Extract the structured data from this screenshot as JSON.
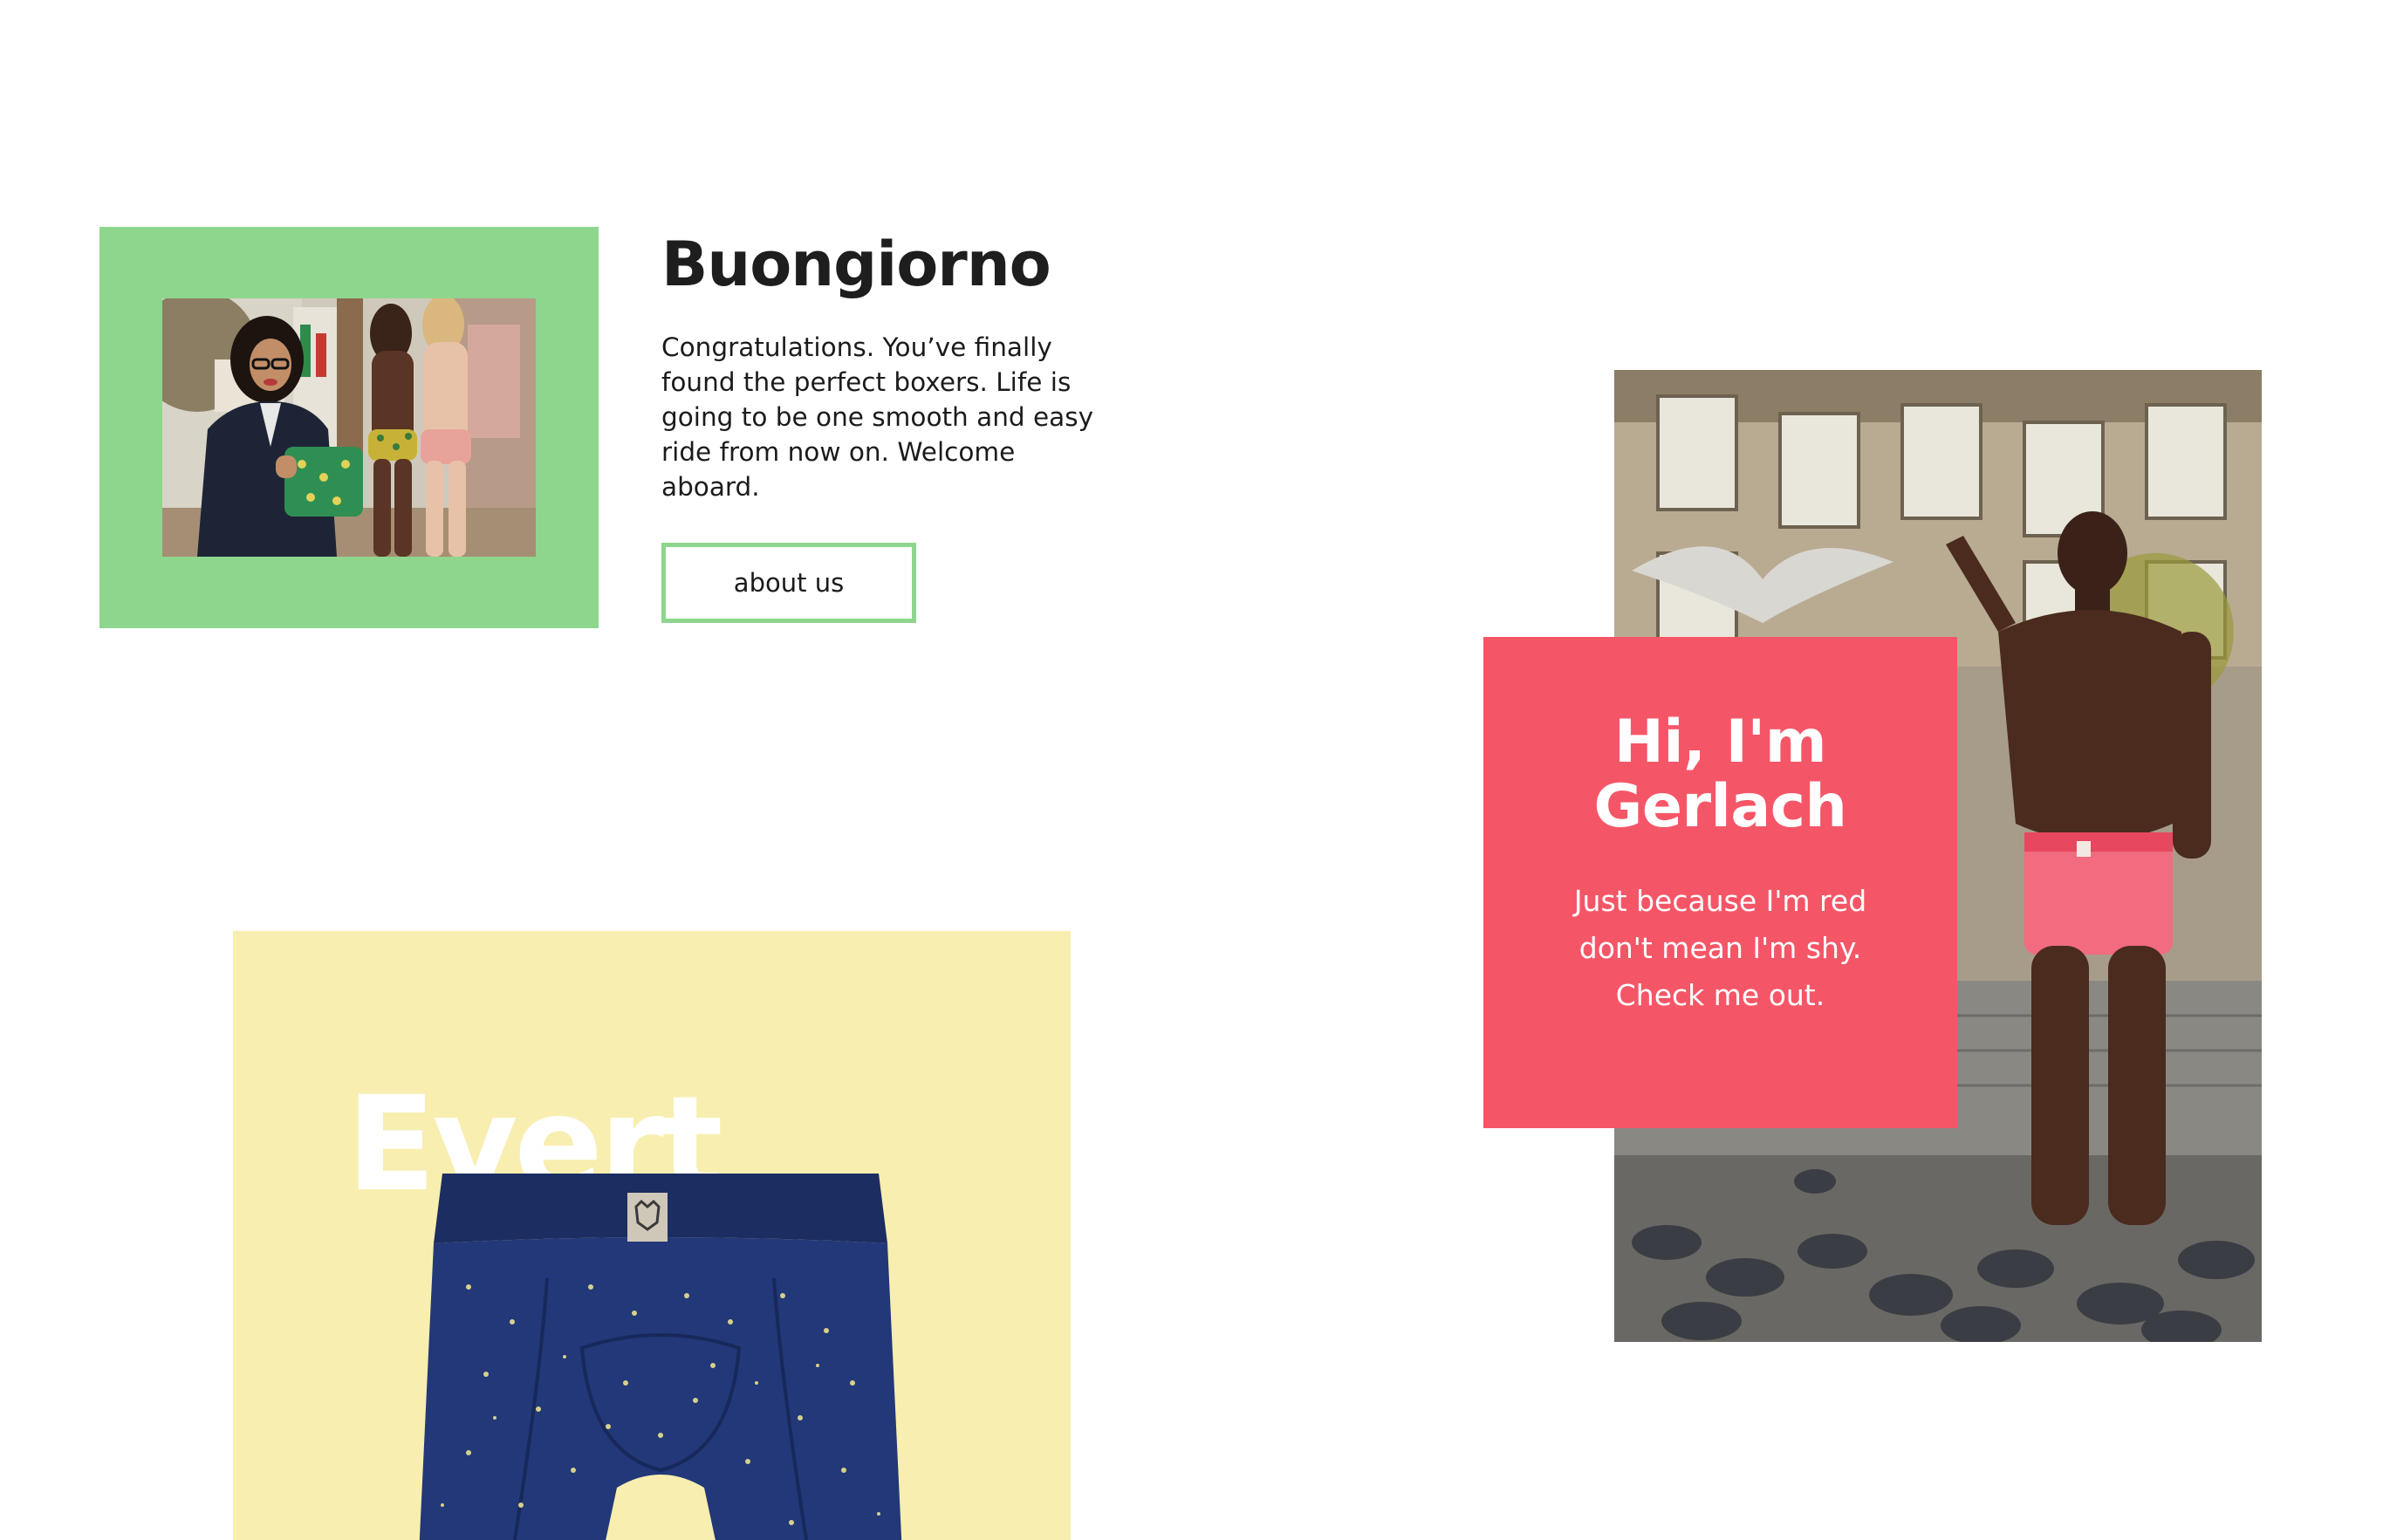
{
  "about": {
    "title": "Buongiorno",
    "body": "Congratulations. You’ve finally found the perfect boxers. Life is going to be one smooth and easy ride from now on. Welcome aboard.",
    "button_label": "about us"
  },
  "gerlach": {
    "title_line1": "Hi, I'm",
    "title_line2": "Gerlach",
    "text_line1": "Just because I'm red",
    "text_line2": "don't mean I'm shy.",
    "text_line3": "Check me out."
  },
  "product": {
    "name": "Evert"
  },
  "colors": {
    "accent_green": "#8ed68d",
    "accent_red": "#f55667",
    "product_bg": "#f8eeb0",
    "boxer_navy": "#1f326d"
  },
  "icons": {
    "brand_tag": "bear-logo-icon"
  }
}
